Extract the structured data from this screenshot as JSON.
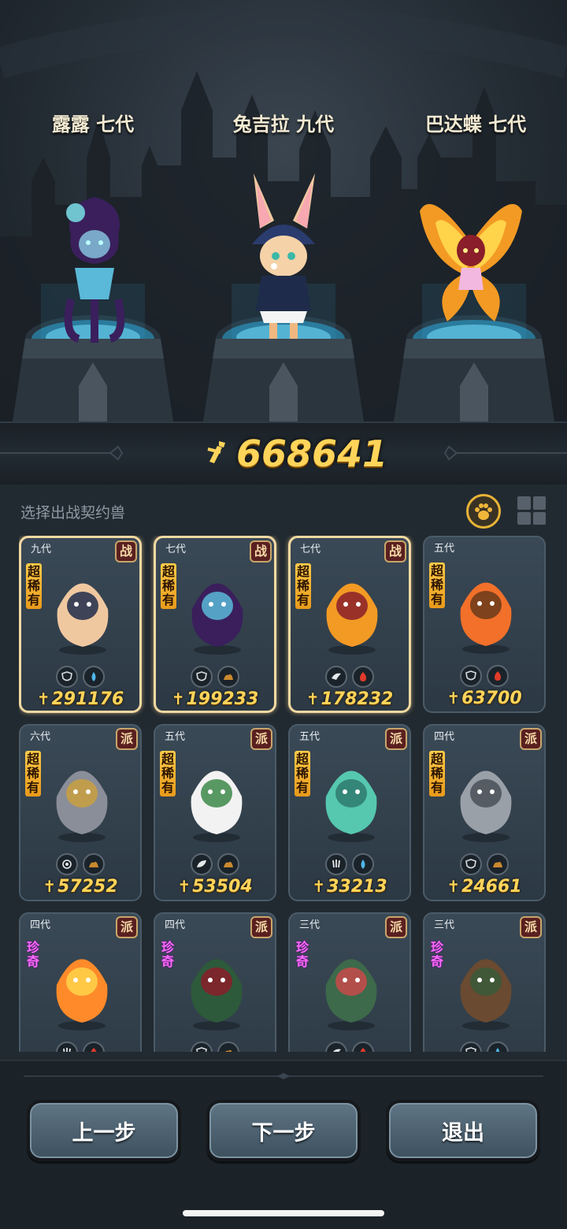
{
  "team": [
    {
      "name": "露露 七代"
    },
    {
      "name": "兔吉拉 九代"
    },
    {
      "name": "巴达蝶 七代"
    }
  ],
  "total_power": "668641",
  "section_label": "选择出战契约兽",
  "colors": {
    "gold": "#ffd45a",
    "panel": "#222a31",
    "card": "#33424e",
    "selected_border": "#f2d9a2"
  },
  "cards": [
    {
      "gen": "九代",
      "tag": "战",
      "rarity": "超稀有",
      "power": "291176",
      "selected": true,
      "attrs": [
        "shield-icon",
        "water-drop-icon"
      ]
    },
    {
      "gen": "七代",
      "tag": "战",
      "rarity": "超稀有",
      "power": "199233",
      "selected": true,
      "attrs": [
        "shield-icon",
        "earth-icon"
      ]
    },
    {
      "gen": "七代",
      "tag": "战",
      "rarity": "超稀有",
      "power": "178232",
      "selected": true,
      "attrs": [
        "wing-icon",
        "fire-icon"
      ]
    },
    {
      "gen": "五代",
      "tag": "",
      "rarity": "超稀有",
      "power": "63700",
      "selected": false,
      "attrs": [
        "shield-icon",
        "fire-icon"
      ]
    },
    {
      "gen": "六代",
      "tag": "派",
      "rarity": "超稀有",
      "power": "57252",
      "selected": false,
      "attrs": [
        "eye-icon",
        "earth-icon"
      ]
    },
    {
      "gen": "五代",
      "tag": "派",
      "rarity": "超稀有",
      "power": "53504",
      "selected": false,
      "attrs": [
        "leaf-icon",
        "earth-icon"
      ]
    },
    {
      "gen": "五代",
      "tag": "派",
      "rarity": "超稀有",
      "power": "33213",
      "selected": false,
      "attrs": [
        "claw-icon",
        "water-drop-icon"
      ]
    },
    {
      "gen": "四代",
      "tag": "派",
      "rarity": "超稀有",
      "power": "24661",
      "selected": false,
      "attrs": [
        "shield-icon",
        "earth-icon"
      ]
    },
    {
      "gen": "四代",
      "tag": "派",
      "rarity": "珍奇",
      "power": "",
      "selected": false,
      "attrs": [
        "claw-icon",
        "fire-icon"
      ]
    },
    {
      "gen": "四代",
      "tag": "派",
      "rarity": "珍奇",
      "power": "",
      "selected": false,
      "attrs": [
        "shield-icon",
        "earth-icon"
      ]
    },
    {
      "gen": "三代",
      "tag": "派",
      "rarity": "珍奇",
      "power": "",
      "selected": false,
      "attrs": [
        "wing-icon",
        "fire-icon"
      ]
    },
    {
      "gen": "三代",
      "tag": "派",
      "rarity": "珍奇",
      "power": "",
      "selected": false,
      "attrs": [
        "shield-icon",
        "water-drop-icon"
      ]
    }
  ],
  "buttons": {
    "prev": "上一步",
    "next": "下一步",
    "exit": "退出"
  }
}
